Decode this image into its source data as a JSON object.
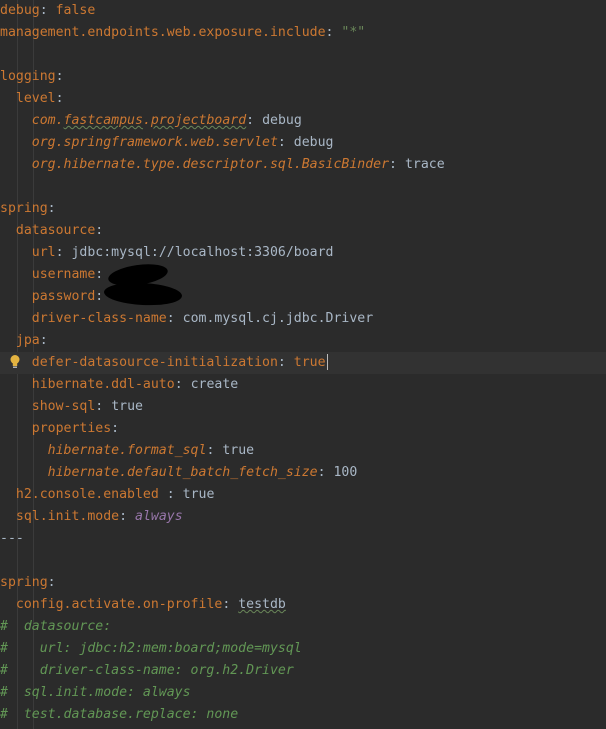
{
  "lines": {
    "l01": {
      "key": "debug",
      "sep": ": ",
      "val": "false"
    },
    "l02": {
      "key": "management.endpoints.web.exposure.include",
      "sep": ": ",
      "val": "\"*\""
    },
    "l04": {
      "key": "logging",
      "sep": ":"
    },
    "l05": {
      "key": "level",
      "sep": ":"
    },
    "l06": {
      "pre": "com.",
      "sub1": "fastcampus",
      "mid": ".",
      "sub2": "projectboard",
      "sep": ": ",
      "val": "debug"
    },
    "l07": {
      "key": "org.springframework.web.servlet",
      "sep": ": ",
      "val": "debug"
    },
    "l08": {
      "key": "org.hibernate.type.descriptor.sql.BasicBinder",
      "sep": ": ",
      "val": "trace"
    },
    "l10": {
      "key": "spring",
      "sep": ":"
    },
    "l11": {
      "key": "datasource",
      "sep": ":"
    },
    "l12": {
      "key": "url",
      "sep": ": ",
      "val": "jdbc:mysql://localhost:3306/board"
    },
    "l13": {
      "key": "username",
      "sep": ":"
    },
    "l14": {
      "key": "password",
      "sep": ":"
    },
    "l15": {
      "key": "driver-class-name",
      "sep": ": ",
      "val": "com.mysql.cj.jdbc.Driver"
    },
    "l16": {
      "key": "jpa",
      "sep": ":"
    },
    "l17": {
      "key": "defer-datasource-initialization",
      "sep": ": ",
      "val": "true"
    },
    "l18": {
      "key": "hibernate.ddl-auto",
      "sep": ": ",
      "val": "create"
    },
    "l19": {
      "key": "show-sql",
      "sep": ": ",
      "val": "true"
    },
    "l20": {
      "key": "properties",
      "sep": ":"
    },
    "l21": {
      "key": "hibernate.format_sql",
      "sep": ": ",
      "val": "true"
    },
    "l22": {
      "key": "hibernate.default_batch_fetch_size",
      "sep": ": ",
      "val": "100"
    },
    "l23": {
      "key": "h2.console.enabled ",
      "sep": ": ",
      "val": "true"
    },
    "l24": {
      "key": "sql.init.mode",
      "sep": ": ",
      "val": "always"
    },
    "l25": {
      "text": "---"
    },
    "l27": {
      "key": "spring",
      "sep": ":"
    },
    "l28": {
      "key": "config.activate.on-profile",
      "sep": ": ",
      "val": "testdb"
    },
    "l29": {
      "text": "#  datasource:"
    },
    "l30": {
      "text": "#    url: jdbc:h2:mem:board;mode=mysql"
    },
    "l31": {
      "text": "#    driver-class-name: org.h2.Driver"
    },
    "l32": {
      "text": "#  sql.init.mode: always"
    },
    "l33": {
      "text": "#  test.database.replace: none"
    }
  },
  "colors": {
    "background": "#2b2b2b",
    "key": "#cc7832",
    "value": "#a9b7c6",
    "string": "#6a8759",
    "comment": "#629755",
    "italic_value": "#9876aa"
  },
  "icons": {
    "intention": "lightbulb-icon"
  }
}
